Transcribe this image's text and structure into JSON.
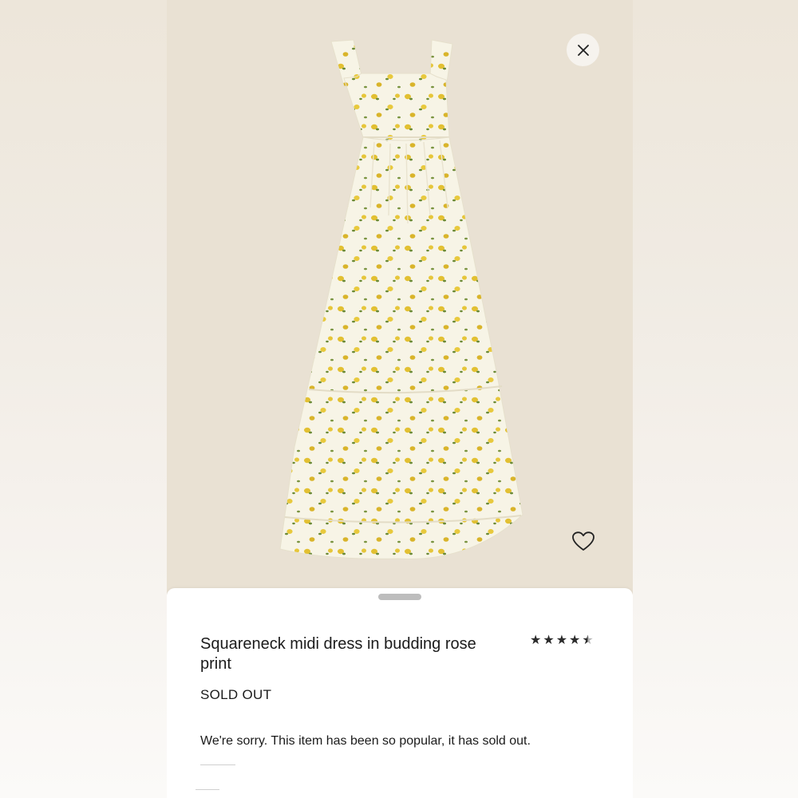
{
  "product": {
    "title": "Squareneck midi dress in budding rose print",
    "status": "SOLD OUT",
    "message": "We're sorry. This item has been so popular, it has sold out.",
    "rating": 4.5,
    "rating_max": 5
  },
  "icons": {
    "close": "close-icon",
    "favorite": "heart-icon",
    "stars": "star-icon"
  },
  "colors": {
    "image_background": "#e9e1d3",
    "dress_base": "#f7f4e6",
    "print_yellow": "#e2c032",
    "print_green": "#6b8a36",
    "text": "#1b1b1b"
  }
}
